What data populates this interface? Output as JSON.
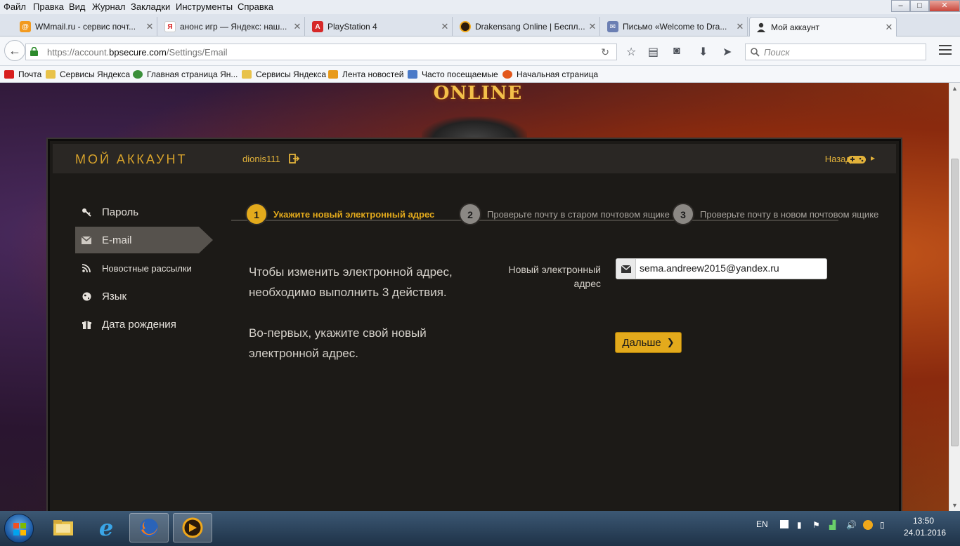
{
  "menubar": {
    "items": [
      "Файл",
      "Правка",
      "Вид",
      "Журнал",
      "Закладки",
      "Инструменты",
      "Справка"
    ]
  },
  "tabs": [
    {
      "label": "WMmail.ru - сервис почт...",
      "icon": "wmmail-icon",
      "color": "#f29a1f"
    },
    {
      "label": "анонс игр — Яндекс: наш...",
      "icon": "yandex-icon",
      "color": "#ffffff"
    },
    {
      "label": "PlayStation 4",
      "icon": "playstation-icon",
      "color": "#d62828"
    },
    {
      "label": "Drakensang Online | Беспл...",
      "icon": "drakensang-icon",
      "color": "#f0a81a"
    },
    {
      "label": "Письмо «Welcome to Dra...",
      "icon": "mail-icon",
      "color": "#6b7fb3"
    },
    {
      "label": "Мой аккаунт",
      "icon": "person-icon",
      "color": "#333333"
    }
  ],
  "navbar": {
    "url_prefix": "https://account.",
    "url_domain": "bpsecure.com",
    "url_path": "/Settings/Email",
    "search_placeholder": "Поиск"
  },
  "bookmarks": [
    {
      "label": "Почта",
      "icon": "mail-bookmark-icon",
      "color": "#d81e1e"
    },
    {
      "label": "Сервисы Яндекса",
      "icon": "folder-icon",
      "color": "#e8c24a"
    },
    {
      "label": "Главная страница Ян...",
      "icon": "globe-icon",
      "color": "#3a8f3a"
    },
    {
      "label": "Сервисы Яндекса",
      "icon": "folder-icon",
      "color": "#e8c24a"
    },
    {
      "label": "Лента новостей",
      "icon": "rss-icon",
      "color": "#e89a1a"
    },
    {
      "label": "Часто посещаемые",
      "icon": "history-icon",
      "color": "#4a7ac8"
    },
    {
      "label": "Начальная страница",
      "icon": "firefox-icon",
      "color": "#e2561a"
    }
  ],
  "game": {
    "logo_text": "ONLINE"
  },
  "account": {
    "title": "МОЙ АККАУНТ",
    "username": "dionis111",
    "back_label": "Назад"
  },
  "sidebar": {
    "items": [
      {
        "label": "Пароль",
        "icon": "key-icon"
      },
      {
        "label": "E-mail",
        "icon": "envelope-icon",
        "active": true
      },
      {
        "label": "Новостные рассылки",
        "icon": "rss-feed-icon"
      },
      {
        "label": "Язык",
        "icon": "globe-icon"
      },
      {
        "label": "Дата рождения",
        "icon": "gift-icon"
      }
    ]
  },
  "steps": [
    {
      "num": "1",
      "label": "Укажите новый электронный адрес",
      "active": true
    },
    {
      "num": "2",
      "label": "Проверьте почту в старом почтовом ящике",
      "active": false
    },
    {
      "num": "3",
      "label": "Проверьте почту в новом почтовом ящике",
      "active": false
    }
  ],
  "content": {
    "instruction_1": "Чтобы изменить электронной адрес, необходимо выполнить 3 действия.",
    "instruction_2": "Во-первых, укажите свой новый электронной адрес.",
    "field_label": "Новый электронный адрес",
    "email_value": "sema.andreew2015@yandex.ru",
    "next_label": "Дальше"
  },
  "taskbar": {
    "apps": [
      "file-explorer-icon",
      "internet-explorer-icon",
      "firefox-icon",
      "drakensang-icon"
    ],
    "language": "EN",
    "time": "13:50",
    "date": "24.01.2016"
  },
  "colors": {
    "accent": "#e3aa1c",
    "panel_bg": "#1c1a17",
    "header_bg": "#2a2724",
    "active_side": "#56524d"
  }
}
